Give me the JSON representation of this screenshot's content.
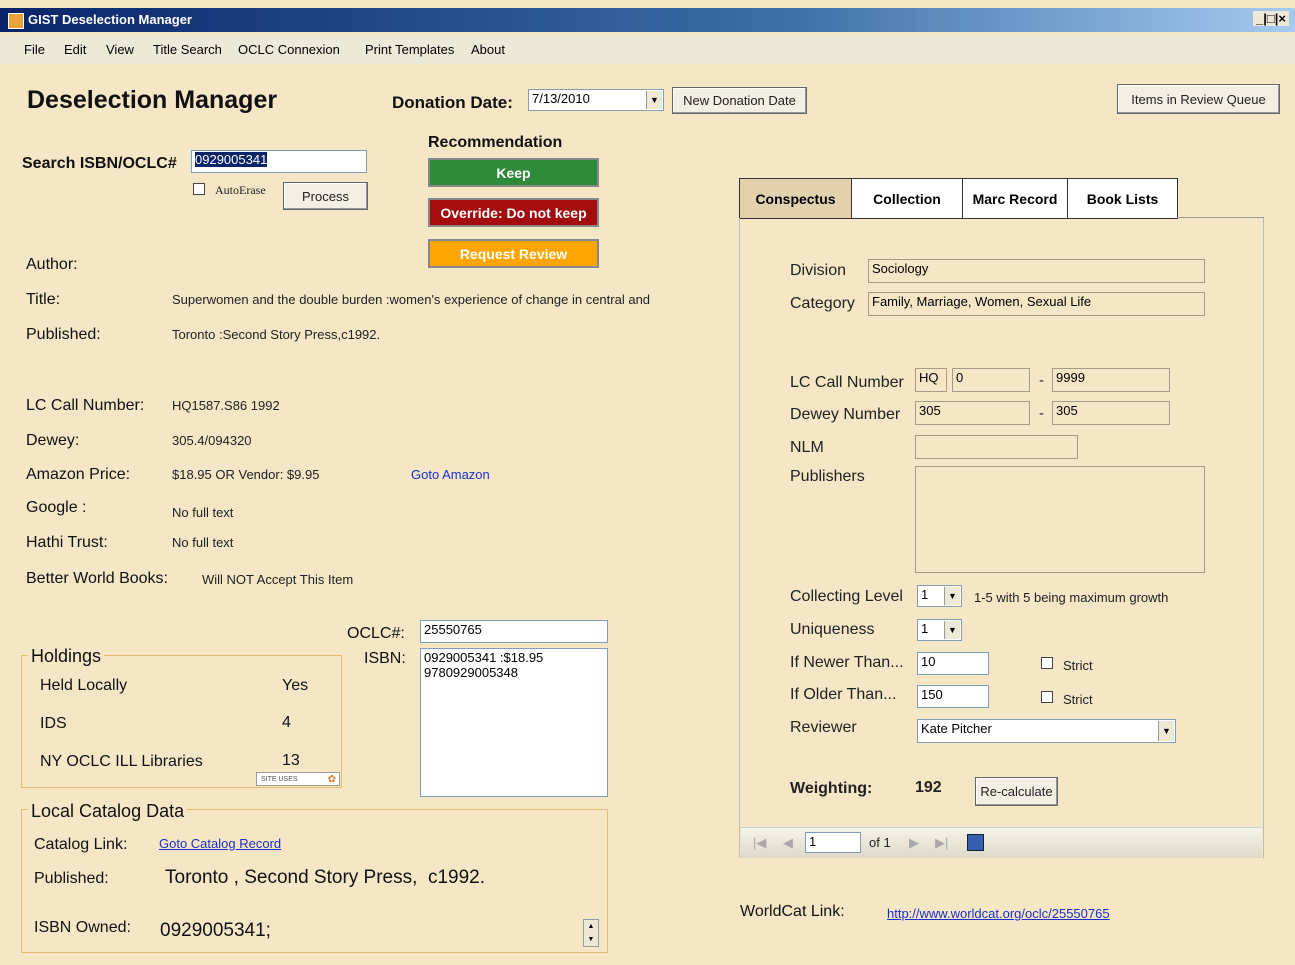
{
  "window": {
    "title": "GIST Deselection Manager",
    "controls": "_|□|×"
  },
  "menu": [
    "File",
    "Edit",
    "View",
    "Title Search",
    "OCLC Connexion",
    "Print Templates",
    "About"
  ],
  "header": {
    "app_title": "Deselection Manager",
    "donation_date_label": "Donation Date:",
    "donation_date_value": "7/13/2010",
    "new_donation_button": "New Donation Date",
    "review_queue_button": "Items in Review Queue"
  },
  "search": {
    "label": "Search ISBN/OCLC#",
    "value": "0929005341",
    "autoerase_label": "AutoErase",
    "process_button": "Process"
  },
  "recommendation": {
    "label": "Recommendation",
    "keep": "Keep",
    "override": "Override:  Do not keep",
    "review": "Request Review",
    "colors": {
      "keep": "#2e8b3a",
      "override": "#a40d0d",
      "review": "#ffa500"
    }
  },
  "record": {
    "author_label": "Author:",
    "author_value": "",
    "title_label": "Title:",
    "title_value": "Superwomen and the double burden :women's experience of change in central and easter",
    "published_label": "Published:",
    "published_value": "Toronto :Second Story Press,c1992.",
    "lc_label": "LC Call Number:",
    "lc_value": "HQ1587.S86 1992",
    "dewey_label": "Dewey:",
    "dewey_value": "305.4/094320",
    "amazon_label": "Amazon Price:",
    "amazon_value": "$18.95 OR Vendor: $9.95",
    "amazon_link": "Goto Amazon",
    "google_label": "Google :",
    "google_value": "No full text",
    "hathi_label": "Hathi Trust:",
    "hathi_value": "No full text",
    "bwb_label": "Better World Books:",
    "bwb_value": "Will NOT Accept This Item"
  },
  "identifiers": {
    "oclc_label": "OCLC#:",
    "oclc_value": "25550765",
    "isbn_label": "ISBN:",
    "isbn_lines": [
      "0929005341 :$18.95",
      "9780929005348"
    ]
  },
  "holdings": {
    "legend": "Holdings",
    "rows": [
      {
        "label": "Held Locally",
        "value": "Yes"
      },
      {
        "label": "IDS",
        "value": "4"
      },
      {
        "label": "NY OCLC ILL Libraries",
        "value": "13"
      }
    ],
    "badge": "SITE USES"
  },
  "local_catalog": {
    "legend": "Local Catalog Data",
    "link_label": "Catalog Link:",
    "link_text": "Goto Catalog Record",
    "published_label": "Published:",
    "published_value": "Toronto , Second Story Press,  c1992.",
    "isbn_label": "ISBN Owned:",
    "isbn_value": "0929005341;"
  },
  "tabs": [
    "Conspectus",
    "Collection",
    "Marc Record",
    "Book Lists"
  ],
  "conspectus": {
    "division_label": "Division",
    "division_value": "Sociology",
    "category_label": "Category",
    "category_value": "Family, Marriage, Women, Sexual Life",
    "lc_label": "LC Call Number",
    "lc_class": "HQ",
    "lc_from": "0",
    "lc_to": "9999",
    "dewey_label": "Dewey Number",
    "dewey_from": "305",
    "dewey_to": "305",
    "nlm_label": "NLM",
    "nlm_value": "",
    "publishers_label": "Publishers",
    "collecting_label": "Collecting Level",
    "collecting_value": "1",
    "collecting_note": "1-5 with 5 being maximum growth",
    "uniqueness_label": "Uniqueness",
    "uniqueness_value": "1",
    "newer_label": "If Newer Than...",
    "newer_value": "10",
    "older_label": "If Older Than...",
    "older_value": "150",
    "strict_label": "Strict",
    "reviewer_label": "Reviewer",
    "reviewer_value": "Kate Pitcher",
    "weighting_label": "Weighting:",
    "weighting_value": "192",
    "recalc_button": "Re-calculate"
  },
  "pager": {
    "page": "1",
    "of": "of 1"
  },
  "worldcat": {
    "label": "WorldCat Link:",
    "url": "http://www.worldcat.org/oclc/25550765"
  }
}
